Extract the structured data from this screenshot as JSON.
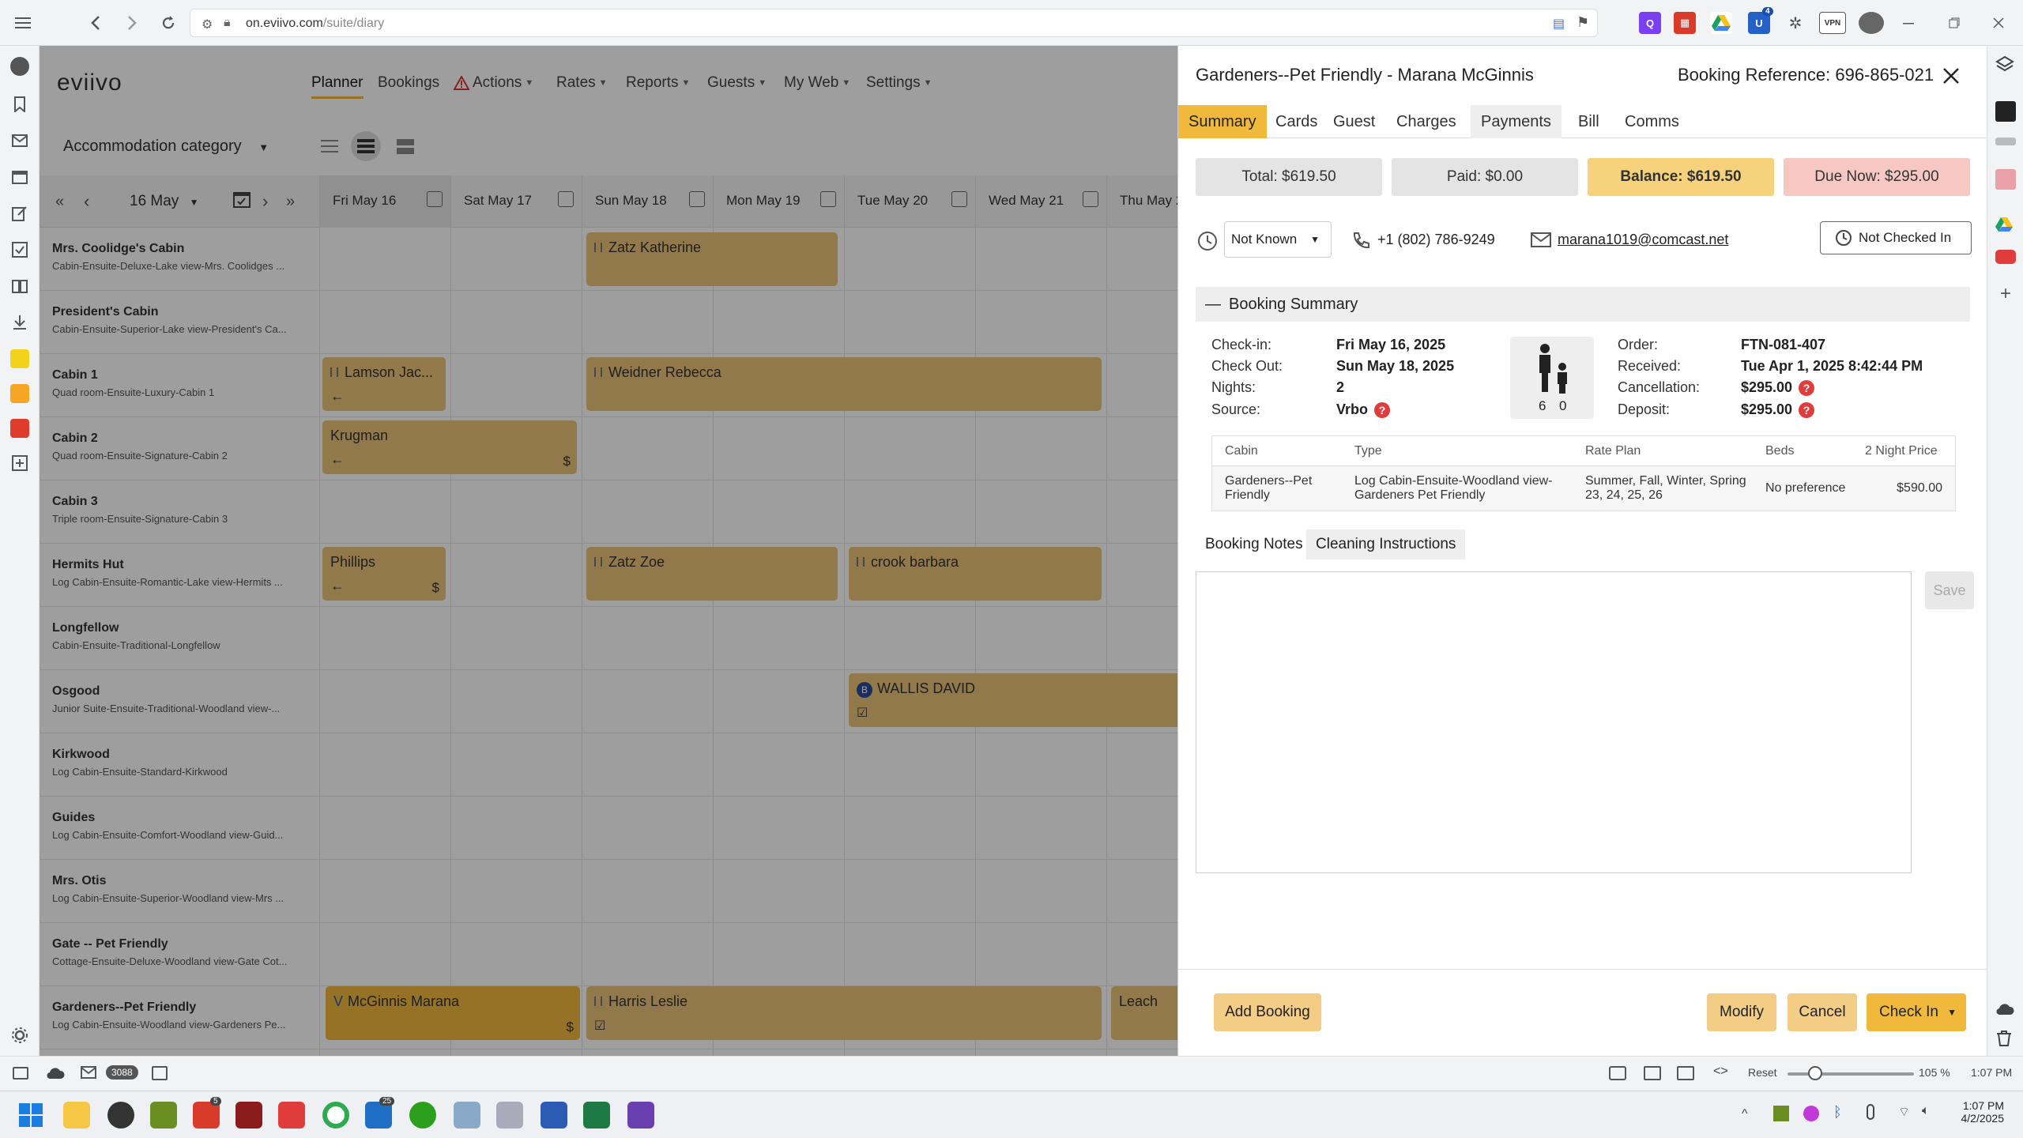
{
  "browser": {
    "url_domain": "on.eviivo.com",
    "url_path": "/suite/diary",
    "extension_badge": "4"
  },
  "app": {
    "logo": "eviivo",
    "nav": [
      {
        "label": "Planner",
        "active": true
      },
      {
        "label": "Bookings"
      },
      {
        "label": "Actions"
      },
      {
        "label": "Rates"
      },
      {
        "label": "Reports"
      },
      {
        "label": "Guests"
      },
      {
        "label": "My Web"
      },
      {
        "label": "Settings"
      }
    ],
    "category_label": "Accommodation category",
    "date_label": "16 May",
    "days": [
      "Fri May 16",
      "Sat May 17",
      "Sun May 18",
      "Mon May 19",
      "Tue May 20",
      "Wed May 21",
      "Thu May 2"
    ],
    "rooms": [
      {
        "name": "Mrs. Coolidge's Cabin",
        "sub": "Cabin-Ensuite-Deluxe-Lake view-Mrs. Coolidges ..."
      },
      {
        "name": "President's Cabin",
        "sub": "Cabin-Ensuite-Superior-Lake view-President's Ca..."
      },
      {
        "name": "Cabin 1",
        "sub": "Quad room-Ensuite-Luxury-Cabin 1"
      },
      {
        "name": "Cabin 2",
        "sub": "Quad room-Ensuite-Signature-Cabin 2"
      },
      {
        "name": "Cabin 3",
        "sub": "Triple room-Ensuite-Signature-Cabin 3"
      },
      {
        "name": "Hermits Hut",
        "sub": "Log Cabin-Ensuite-Romantic-Lake view-Hermits ..."
      },
      {
        "name": "Longfellow",
        "sub": "Cabin-Ensuite-Traditional-Longfellow"
      },
      {
        "name": "Osgood",
        "sub": "Junior Suite-Ensuite-Traditional-Woodland view-..."
      },
      {
        "name": "Kirkwood",
        "sub": "Log Cabin-Ensuite-Standard-Kirkwood"
      },
      {
        "name": "Guides",
        "sub": "Log Cabin-Ensuite-Comfort-Woodland view-Guid..."
      },
      {
        "name": "Mrs. Otis",
        "sub": "Log Cabin-Ensuite-Superior-Woodland view-Mrs ..."
      },
      {
        "name": "Gate -- Pet Friendly",
        "sub": "Cottage-Ensuite-Deluxe-Woodland view-Gate Cot..."
      },
      {
        "name": "Gardeners--Pet Friendly",
        "sub": "Log Cabin-Ensuite-Woodland view-Gardeners Pe..."
      }
    ],
    "bookings": [
      {
        "guest": "Zatz Katherine"
      },
      {
        "guest": "Lamson Jac..."
      },
      {
        "guest": "Weidner Rebecca"
      },
      {
        "guest": "Krugman"
      },
      {
        "guest": "Phillips"
      },
      {
        "guest": "Zatz Zoe"
      },
      {
        "guest": "crook barbara"
      },
      {
        "guest": "WALLIS DAVID"
      },
      {
        "guest": "McGinnis Marana"
      },
      {
        "guest": "Harris Leslie"
      },
      {
        "guest": "Leach"
      }
    ],
    "dollar": "$",
    "b_badge": "B"
  },
  "drawer": {
    "title": "Gardeners--Pet Friendly - Marana McGinnis",
    "booking_ref": "Booking Reference: 696-865-021",
    "tabs": [
      "Summary",
      "Cards",
      "Guest",
      "Charges",
      "Payments",
      "Bill",
      "Comms"
    ],
    "total": "Total: $619.50",
    "paid": "Paid: $0.00",
    "balance": "Balance: $619.50",
    "due_now": "Due Now: $295.00",
    "arrival_time": "Not Known",
    "phone": "+1 (802) 786-9249",
    "email": "marana1019@comcast.net",
    "checkin_status": "Not Checked In",
    "summary_header": "Booking Summary",
    "collapse": "—",
    "checkin_label": "Check-in:",
    "checkin_value": "Fri May 16, 2025",
    "checkout_label": "Check Out:",
    "checkout_value": "Sun May 18, 2025",
    "nights_label": "Nights:",
    "nights_value": "2",
    "source_label": "Source:",
    "source_value": "Vrbo",
    "adults": "6",
    "children": "0",
    "order_label": "Order:",
    "order_value": "FTN-081-407",
    "received_label": "Received:",
    "received_value": "Tue Apr 1, 2025 8:42:44 PM",
    "cancellation_label": "Cancellation:",
    "cancellation_value": "$295.00",
    "deposit_label": "Deposit:",
    "deposit_value": "$295.00",
    "help_glyph": "?",
    "rate_table": {
      "headers": [
        "Cabin",
        "Type",
        "Rate Plan",
        "Beds",
        "2 Night Price"
      ],
      "row": [
        "Gardeners--Pet Friendly",
        "Log Cabin-Ensuite-Woodland view-Gardeners Pet Friendly",
        "Summer, Fall, Winter, Spring 23, 24, 25, 26",
        "No preference",
        "$590.00"
      ]
    },
    "note_tabs": [
      "Booking Notes",
      "Cleaning Instructions"
    ],
    "save": "Save",
    "buttons": {
      "add_booking": "Add Booking",
      "modify": "Modify",
      "cancel": "Cancel",
      "check_in": "Check In"
    }
  },
  "statusbar": {
    "badge": "3088",
    "reset": "Reset",
    "zoom": "105 %",
    "time": "1:07 PM"
  },
  "taskbar": {
    "time": "1:07 PM",
    "date": "4/2/2025",
    "badge_a": "5",
    "badge_b": "25"
  },
  "colors": {
    "accent": "#f0b93c",
    "booking": "#eac47a",
    "balance": "#f6d27c",
    "due": "#f6c7c3"
  }
}
